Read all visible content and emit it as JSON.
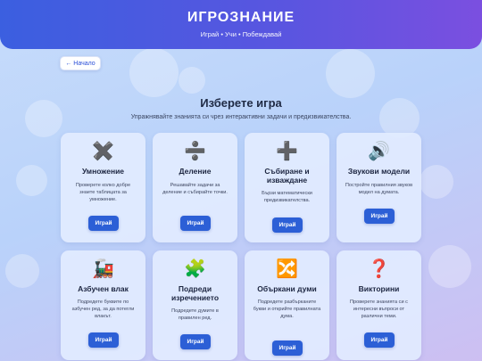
{
  "header": {
    "title": "ИГРОЗНАНИЕ",
    "tagline": "Играй • Учи • Побеждавай"
  },
  "back_button": {
    "label": "← Начало"
  },
  "main": {
    "title": "Изберете игра",
    "subtitle": "Упражнявайте знанията си чрез интерактивни задачи и предизвикателства."
  },
  "games": [
    {
      "icon": "✖️",
      "icon_name": "multiplication-icon",
      "name": "Умножение",
      "description": "Проверете колко добре знаете таблицата за умножение.",
      "button": "Играй"
    },
    {
      "icon": "➗",
      "icon_name": "division-icon",
      "name": "Деление",
      "description": "Решавайте задачи за деление и събирайте точки.",
      "button": "Играй"
    },
    {
      "icon": "➕",
      "icon_name": "addition-icon",
      "name": "Събиране и изваждане",
      "description": "Бързи математически предизвикателства.",
      "button": "Играй"
    },
    {
      "icon": "🔊",
      "icon_name": "speaker-icon",
      "name": "Звукови модели",
      "description": "Постройте правилния звуков модел на думата.",
      "button": "Играй"
    },
    {
      "icon": "🚂",
      "icon_name": "train-icon",
      "name": "Азбучен влак",
      "description": "Подредете буквите по азбучен ред, за да потегли влакът.",
      "button": "Играй"
    },
    {
      "icon": "🧩",
      "icon_name": "puzzle-icon",
      "name": "Подреди изречението",
      "description": "Подредете думите в правилен ред.",
      "button": "Играй"
    },
    {
      "icon": "🔀",
      "icon_name": "shuffle-icon",
      "name": "Объркани думи",
      "description": "Подредете разбърканите букви и открийте правилната дума.",
      "button": "Играй"
    },
    {
      "icon": "❓",
      "icon_name": "question-icon",
      "name": "Викторини",
      "description": "Проверете знанията си с интересни въпроси от различни теми.",
      "button": "Играй"
    }
  ]
}
